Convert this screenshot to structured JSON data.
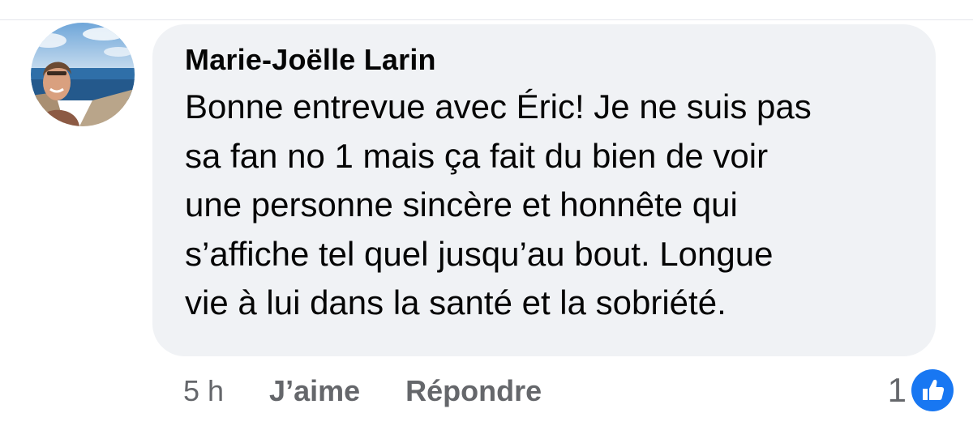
{
  "comment": {
    "author": "Marie-Joëlle Larin",
    "text": "Bonne entrevue avec Éric! Je ne suis pas\nsa fan no 1 mais ça fait du bien de voir\nune personne sincère et honnête qui\ns’affiche tel quel jusqu’au bout. Longue\nvie à lui dans la santé et la sobriété.",
    "avatar": "profile-photo-icon"
  },
  "actions": {
    "timestamp": "5 h",
    "like_label": "J’aime",
    "reply_label": "Répondre"
  },
  "reactions": {
    "count": "1",
    "icon": "like-thumbs-up-icon",
    "badge_color": "#1877f2"
  },
  "colors": {
    "bubble": "#f0f2f5",
    "secondary_text": "#65676b",
    "primary_text": "#050505"
  }
}
